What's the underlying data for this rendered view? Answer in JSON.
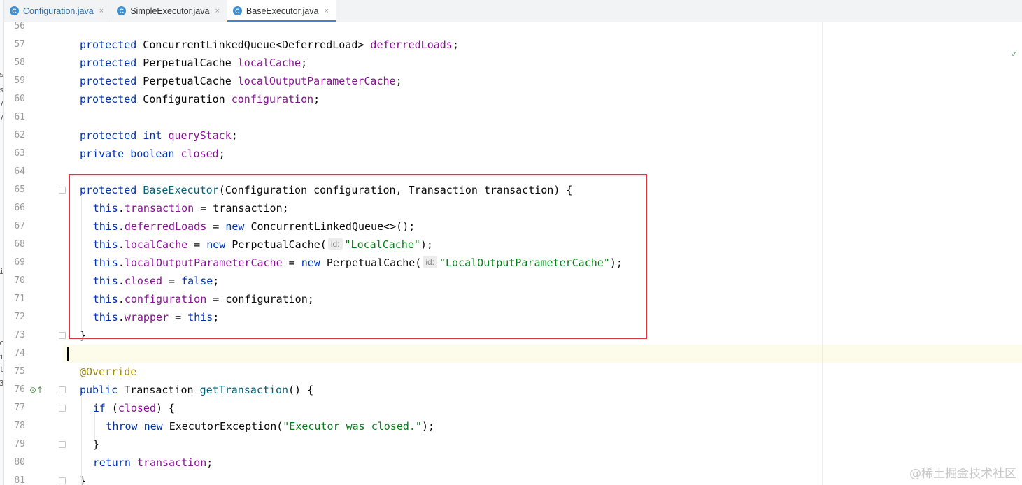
{
  "tabs": [
    {
      "name": "Configuration.java",
      "active": false,
      "icon": "class-icon"
    },
    {
      "name": "SimpleExecutor.java",
      "active": false,
      "icon": "class-icon"
    },
    {
      "name": "BaseExecutor.java",
      "active": true,
      "icon": "class-icon"
    }
  ],
  "tab_icon_letter": "C",
  "close_glyph": "×",
  "left_sliver_chars": [
    "s",
    "s",
    "7",
    "7",
    "i",
    "c",
    "i",
    "t",
    "3"
  ],
  "lines": [
    {
      "n": "56",
      "tokens": []
    },
    {
      "n": "57",
      "tokens": [
        [
          "kw",
          "protected"
        ],
        [
          "",
          "ConcurrentLinkedQueue<DeferredLoad> "
        ],
        [
          "fld",
          "deferredLoads"
        ],
        [
          "",
          ";"
        ]
      ],
      "sep": [
        1
      ]
    },
    {
      "n": "58",
      "tokens": [
        [
          "kw",
          "protected"
        ],
        [
          "",
          "PerpetualCache "
        ],
        [
          "fld",
          "localCache"
        ],
        [
          "",
          ";"
        ]
      ],
      "sep": [
        1
      ]
    },
    {
      "n": "59",
      "tokens": [
        [
          "kw",
          "protected"
        ],
        [
          "",
          "PerpetualCache "
        ],
        [
          "fld",
          "localOutputParameterCache"
        ],
        [
          "",
          ";"
        ]
      ],
      "sep": [
        1
      ]
    },
    {
      "n": "60",
      "tokens": [
        [
          "kw",
          "protected"
        ],
        [
          "",
          "Configuration "
        ],
        [
          "fld",
          "configuration"
        ],
        [
          "",
          ";"
        ]
      ],
      "sep": [
        1
      ]
    },
    {
      "n": "61",
      "tokens": []
    },
    {
      "n": "62",
      "tokens": [
        [
          "kw",
          "protected"
        ],
        [
          "",
          ""
        ],
        [
          "kw",
          "int"
        ],
        [
          "",
          ""
        ],
        [
          "fld",
          "queryStack"
        ],
        [
          "",
          ";"
        ]
      ],
      "sep": [
        1,
        3
      ]
    },
    {
      "n": "63",
      "tokens": [
        [
          "kw",
          "private"
        ],
        [
          "",
          ""
        ],
        [
          "kw",
          "boolean"
        ],
        [
          "",
          ""
        ],
        [
          "fld",
          "closed"
        ],
        [
          "",
          ";"
        ]
      ],
      "sep": [
        1,
        3
      ]
    },
    {
      "n": "64",
      "tokens": []
    },
    {
      "n": "65",
      "tokens": [
        [
          "kw",
          "protected"
        ],
        [
          "",
          ""
        ],
        [
          "mth",
          "BaseExecutor"
        ],
        [
          "",
          "(Configuration configuration, Transaction transaction) {"
        ]
      ],
      "sep": [
        1
      ]
    },
    {
      "n": "66",
      "indent": 1,
      "tokens": [
        [
          "kw",
          "this"
        ],
        [
          "",
          "."
        ],
        [
          "fld",
          "transaction"
        ],
        [
          "",
          " = transaction;"
        ]
      ]
    },
    {
      "n": "67",
      "indent": 1,
      "tokens": [
        [
          "kw",
          "this"
        ],
        [
          "",
          "."
        ],
        [
          "fld",
          "deferredLoads"
        ],
        [
          "",
          " = "
        ],
        [
          "kw",
          "new"
        ],
        [
          "",
          " ConcurrentLinkedQueue<>();"
        ]
      ]
    },
    {
      "n": "68",
      "indent": 1,
      "tokens": [
        [
          "kw",
          "this"
        ],
        [
          "",
          "."
        ],
        [
          "fld",
          "localCache"
        ],
        [
          "",
          " = "
        ],
        [
          "kw",
          "new"
        ],
        [
          "",
          " PerpetualCache("
        ],
        [
          "hint",
          "id:"
        ],
        [
          "str",
          "\"LocalCache\""
        ],
        [
          "",
          ");"
        ]
      ]
    },
    {
      "n": "69",
      "indent": 1,
      "tokens": [
        [
          "kw",
          "this"
        ],
        [
          "",
          "."
        ],
        [
          "fld",
          "localOutputParameterCache"
        ],
        [
          "",
          " = "
        ],
        [
          "kw",
          "new"
        ],
        [
          "",
          " PerpetualCache("
        ],
        [
          "hint",
          "id:"
        ],
        [
          "str",
          "\"LocalOutputParameterCache\""
        ],
        [
          "",
          ");"
        ]
      ]
    },
    {
      "n": "70",
      "indent": 1,
      "tokens": [
        [
          "kw",
          "this"
        ],
        [
          "",
          "."
        ],
        [
          "fld",
          "closed"
        ],
        [
          "",
          " = "
        ],
        [
          "kw",
          "false"
        ],
        [
          "",
          ";"
        ]
      ]
    },
    {
      "n": "71",
      "indent": 1,
      "tokens": [
        [
          "kw",
          "this"
        ],
        [
          "",
          "."
        ],
        [
          "fld",
          "configuration"
        ],
        [
          "",
          " = configuration;"
        ]
      ]
    },
    {
      "n": "72",
      "indent": 1,
      "tokens": [
        [
          "kw",
          "this"
        ],
        [
          "",
          "."
        ],
        [
          "fld",
          "wrapper"
        ],
        [
          "",
          " = "
        ],
        [
          "kw",
          "this"
        ],
        [
          "",
          ";"
        ]
      ]
    },
    {
      "n": "73",
      "tokens": [
        [
          "",
          "}"
        ]
      ]
    },
    {
      "n": "74",
      "tokens": [],
      "current": true
    },
    {
      "n": "75",
      "tokens": [
        [
          "ann",
          "@Override"
        ]
      ]
    },
    {
      "n": "76",
      "tokens": [
        [
          "kw",
          "public"
        ],
        [
          "",
          "Transaction "
        ],
        [
          "mth",
          "getTransaction"
        ],
        [
          "",
          "() {"
        ]
      ],
      "sep": [
        1
      ],
      "marker": true
    },
    {
      "n": "77",
      "indent": 1,
      "tokens": [
        [
          "kw",
          "if"
        ],
        [
          "",
          " ("
        ],
        [
          "fld",
          "closed"
        ],
        [
          "",
          ") {"
        ]
      ]
    },
    {
      "n": "78",
      "indent": 2,
      "tokens": [
        [
          "kw",
          "throw"
        ],
        [
          "",
          ""
        ],
        [
          "kw",
          "new"
        ],
        [
          "",
          " ExecutorException("
        ],
        [
          "str",
          "\"Executor was closed.\""
        ],
        [
          "",
          ");"
        ]
      ],
      "sep": [
        1
      ]
    },
    {
      "n": "79",
      "indent": 1,
      "tokens": [
        [
          "",
          "}"
        ]
      ]
    },
    {
      "n": "80",
      "indent": 1,
      "tokens": [
        [
          "kw",
          "return"
        ],
        [
          "",
          ""
        ],
        [
          "fld",
          "transaction"
        ],
        [
          "",
          ";"
        ]
      ],
      "sep": [
        1
      ]
    },
    {
      "n": "81",
      "tokens": [
        [
          "",
          "}"
        ]
      ]
    }
  ],
  "fold_lines": [
    "65",
    "73",
    "76",
    "77",
    "79",
    "81"
  ],
  "gutter_marker_glyph": "⊙↑",
  "check_mark_glyph": "✓",
  "watermark": "@稀土掘金技术社区"
}
